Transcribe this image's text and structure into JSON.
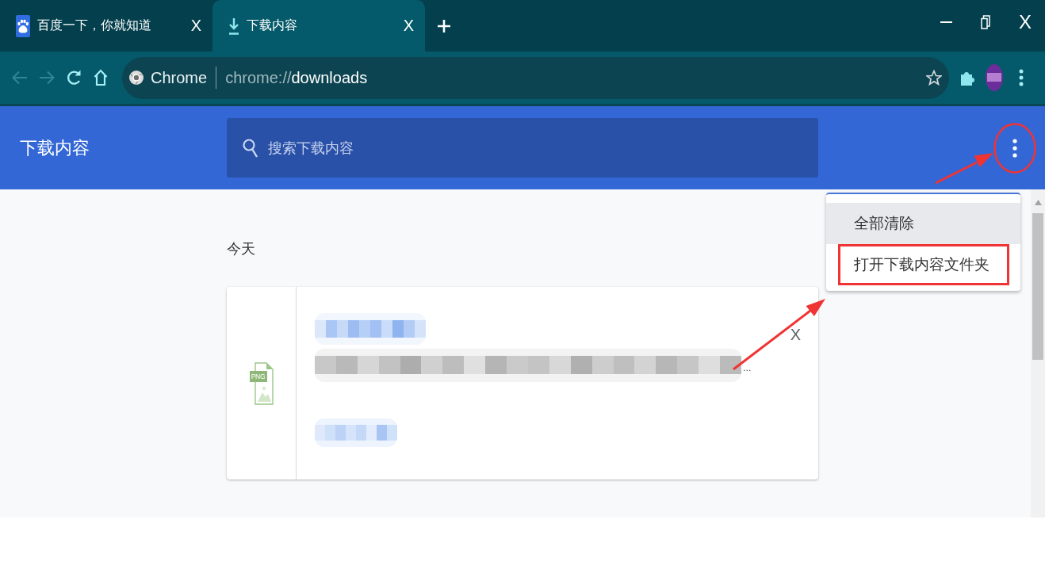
{
  "tabs": [
    {
      "kind": "site",
      "title": "百度一下，你就知道",
      "close_label": "X",
      "selected": false
    },
    {
      "kind": "downloads",
      "title": "下载内容",
      "close_label": "X",
      "selected": true
    }
  ],
  "window_controls": {
    "close_label": "X"
  },
  "toolbar": {
    "back_disabled": true,
    "forward_disabled": true,
    "address": {
      "origin": "Chrome",
      "scheme": "chrome://",
      "path": "downloads"
    }
  },
  "header": {
    "title": "下载内容",
    "search": {
      "placeholder": "搜索下载内容"
    },
    "more_button": {
      "circled": true
    }
  },
  "menu": {
    "items": [
      {
        "label": "全部清除",
        "highlighted": true,
        "outlined": false
      },
      {
        "label": "打开下载内容文件夹",
        "highlighted": false,
        "outlined": true
      }
    ]
  },
  "downloads": {
    "date_heading": "今天",
    "items": [
      {
        "file_type": "PNG",
        "url_ellipsis": "...",
        "remove_label": "X"
      }
    ]
  }
}
